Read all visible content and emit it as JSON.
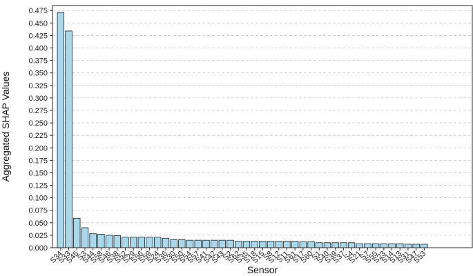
{
  "chart_data": {
    "type": "bar",
    "title": "",
    "xlabel": "Sensor",
    "ylabel": "Aggregated SHAP Values",
    "ylim": [
      0,
      0.485
    ],
    "yticks": [
      "0.000",
      "0.025",
      "0.050",
      "0.075",
      "0.100",
      "0.125",
      "0.150",
      "0.175",
      "0.200",
      "0.225",
      "0.250",
      "0.275",
      "0.300",
      "0.325",
      "0.350",
      "0.375",
      "0.400",
      "0.425",
      "0.450",
      "0.475"
    ],
    "grid": "y-dashed",
    "bar_color": "#a6d8ee",
    "bar_edge_color": "#1a1a1a",
    "categories": [
      "S34",
      "S33",
      "S45",
      "S3",
      "S44",
      "S58",
      "S46",
      "S38",
      "S52",
      "S29",
      "S56",
      "S59",
      "S24",
      "S36",
      "S30",
      "S50",
      "S54",
      "S57",
      "S41",
      "S42",
      "S43",
      "S2",
      "S62",
      "S35",
      "S18",
      "S15",
      "S8",
      "S12",
      "S11",
      "S61",
      "S17",
      "S60",
      "S1",
      "S40",
      "S39",
      "S37",
      "S4",
      "S21",
      "S7",
      "S55",
      "S23",
      "S14",
      "S13",
      "S31",
      "S47",
      "S53"
    ],
    "values": [
      0.471,
      0.434,
      0.059,
      0.04,
      0.028,
      0.027,
      0.025,
      0.024,
      0.021,
      0.021,
      0.021,
      0.021,
      0.021,
      0.019,
      0.016,
      0.016,
      0.015,
      0.015,
      0.015,
      0.015,
      0.015,
      0.015,
      0.013,
      0.013,
      0.013,
      0.013,
      0.013,
      0.013,
      0.013,
      0.013,
      0.012,
      0.012,
      0.01,
      0.01,
      0.01,
      0.01,
      0.01,
      0.008,
      0.008,
      0.008,
      0.008,
      0.008,
      0.008,
      0.007,
      0.007,
      0.007
    ]
  }
}
